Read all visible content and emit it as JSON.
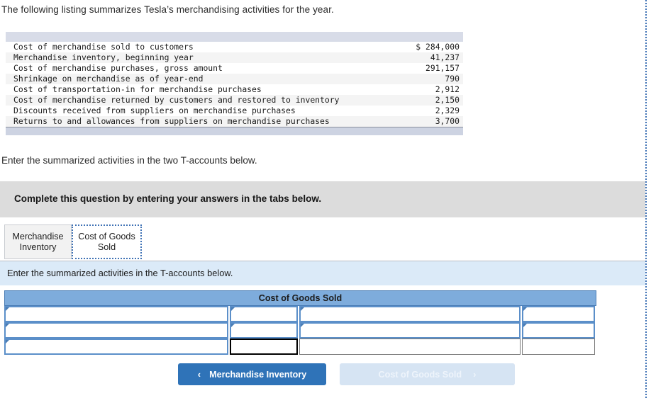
{
  "intro": {
    "prompt": "The following listing summarizes Tesla’s merchandising activities for the year."
  },
  "listing": {
    "rows": [
      {
        "label": "Cost of merchandise sold to customers",
        "amount": "$ 284,000"
      },
      {
        "label": "Merchandise inventory, beginning year",
        "amount": "41,237"
      },
      {
        "label": "Cost of merchandise purchases, gross amount",
        "amount": "291,157"
      },
      {
        "label": "Shrinkage on merchandise as of year-end",
        "amount": "790"
      },
      {
        "label": "Cost of transportation-in for merchandise purchases",
        "amount": "2,912"
      },
      {
        "label": "Cost of merchandise returned by customers and restored to inventory",
        "amount": "2,150"
      },
      {
        "label": "Discounts received from suppliers on merchandise purchases",
        "amount": "2,329"
      },
      {
        "label": "Returns to and allowances from suppliers on merchandise purchases",
        "amount": "3,700"
      }
    ]
  },
  "middle": {
    "instruction": "Enter the summarized activities in the two T-accounts below."
  },
  "banner": {
    "text": "Complete this question by entering your answers in the tabs below."
  },
  "tabs": [
    {
      "label_line1": "Merchandise",
      "label_line2": "Inventory",
      "active": false
    },
    {
      "label_line1": "Cost of Goods",
      "label_line2": "Sold",
      "active": true
    }
  ],
  "blue_bar": {
    "text": "Enter the summarized activities in the T-accounts below."
  },
  "taccount": {
    "title": "Cost of Goods Sold",
    "rows": [
      {
        "cells": [
          {
            "type": "input",
            "value": "",
            "marker": true
          },
          {
            "type": "input",
            "value": "",
            "marker": true
          },
          {
            "type": "input",
            "value": "",
            "marker": true
          },
          {
            "type": "input",
            "value": "",
            "marker": true
          }
        ]
      },
      {
        "cells": [
          {
            "type": "input",
            "value": "",
            "marker": true
          },
          {
            "type": "input",
            "value": "",
            "marker": true
          },
          {
            "type": "input",
            "value": "",
            "marker": true
          },
          {
            "type": "input",
            "value": "",
            "marker": true
          }
        ]
      },
      {
        "cells": [
          {
            "type": "input",
            "value": "",
            "marker": true
          },
          {
            "type": "total",
            "value": "",
            "marker": false
          },
          {
            "type": "plain",
            "value": "",
            "marker": false
          },
          {
            "type": "plain",
            "value": "",
            "marker": false
          }
        ]
      }
    ]
  },
  "footer_buttons": {
    "prev": {
      "label": "Merchandise Inventory",
      "chevron": "chevron-left",
      "glyph": "‹",
      "enabled": true
    },
    "next": {
      "label": "Cost of Goods Sold",
      "chevron": "chevron-right",
      "glyph": "›",
      "enabled": false
    }
  },
  "colors": {
    "accent_blue": "#2f73b8",
    "header_blue": "#7EACDC",
    "banner_gray": "#dcdcdc",
    "info_blue": "#dbeaf8",
    "focus_blue": "#3f72b5"
  }
}
